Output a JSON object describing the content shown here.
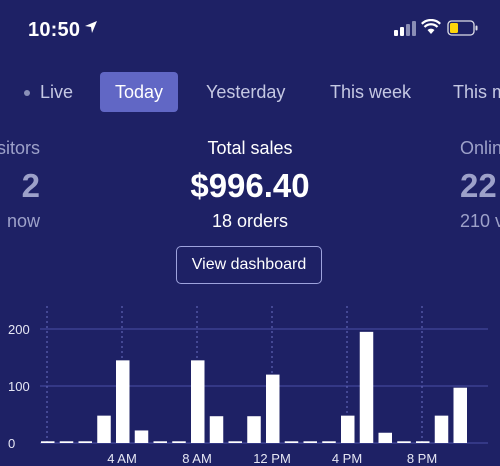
{
  "status_bar": {
    "time": "10:50"
  },
  "tabs": [
    {
      "label": "Live"
    },
    {
      "label": "Today"
    },
    {
      "label": "Yesterday"
    },
    {
      "label": "This week"
    },
    {
      "label": "This m"
    }
  ],
  "metrics": {
    "visitors": {
      "label": "sitors",
      "value": "2",
      "sub": "now"
    },
    "total_sales": {
      "label": "Total sales",
      "value": "$996.40",
      "sub": "18 orders"
    },
    "online": {
      "label": "Onlin",
      "value": "22",
      "sub": "210 v"
    }
  },
  "dashboard_button": {
    "label": "View dashboard"
  },
  "colors": {
    "background": "#1e2165",
    "active_tab": "#6167c5",
    "bar": "#ffffff"
  },
  "chart_data": {
    "type": "bar",
    "x_labels": [
      "4 AM",
      "8 AM",
      "12 PM",
      "4 PM",
      "8 PM"
    ],
    "y_ticks": [
      "0",
      "100",
      "200"
    ],
    "ylim": [
      0,
      200
    ],
    "values": [
      3,
      3,
      3,
      48,
      145,
      22,
      3,
      3,
      145,
      47,
      3,
      47,
      120,
      3,
      3,
      3,
      48,
      195,
      18,
      3,
      3,
      48,
      97
    ]
  }
}
